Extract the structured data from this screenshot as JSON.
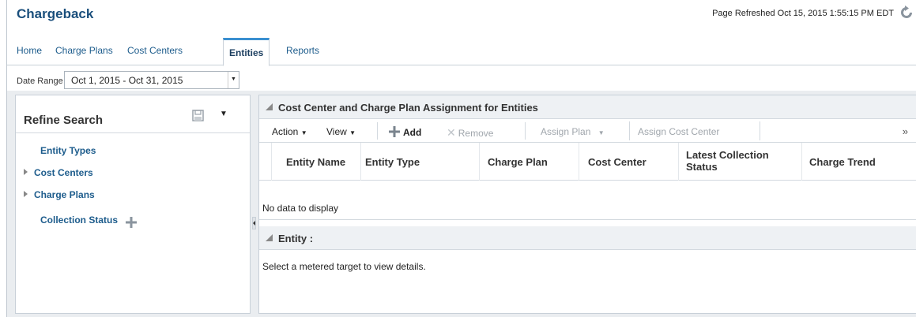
{
  "app": {
    "title": "Chargeback",
    "refreshed": "Page Refreshed Oct 15, 2015 1:55:15 PM EDT"
  },
  "tabs": [
    {
      "label": "Home"
    },
    {
      "label": "Charge Plans"
    },
    {
      "label": "Cost Centers"
    },
    {
      "label": "Entities",
      "active": true
    },
    {
      "label": "Reports"
    }
  ],
  "date_range": {
    "label": "Date Range",
    "value": "Oct 1, 2015 - Oct 31, 2015"
  },
  "refine": {
    "title": "Refine Search",
    "facets": [
      {
        "label": "Entity Types",
        "expandable": false
      },
      {
        "label": "Cost Centers",
        "expandable": true
      },
      {
        "label": "Charge Plans",
        "expandable": true
      },
      {
        "label": "Collection Status",
        "expandable": false
      }
    ]
  },
  "assignment": {
    "title": "Cost Center and Charge Plan Assignment for Entities",
    "toolbar": {
      "action": "Action",
      "view": "View",
      "add": "Add",
      "remove": "Remove",
      "assign_plan": "Assign Plan",
      "assign_cost_center": "Assign Cost Center",
      "more": "»"
    },
    "columns": [
      "Entity Name",
      "Entity Type",
      "Charge Plan",
      "Cost Center",
      "Latest Collection Status",
      "Charge Trend"
    ],
    "empty_text": "No data to display"
  },
  "entity": {
    "title": "Entity :",
    "hint": "Select a metered target to view details."
  },
  "colors": {
    "title": "#1a4f7c",
    "link": "#1d5c8c",
    "active_tab_accent": "#3a8fd0",
    "add_icon": "#4a9a3c",
    "disabled": "#a0a6ac"
  }
}
